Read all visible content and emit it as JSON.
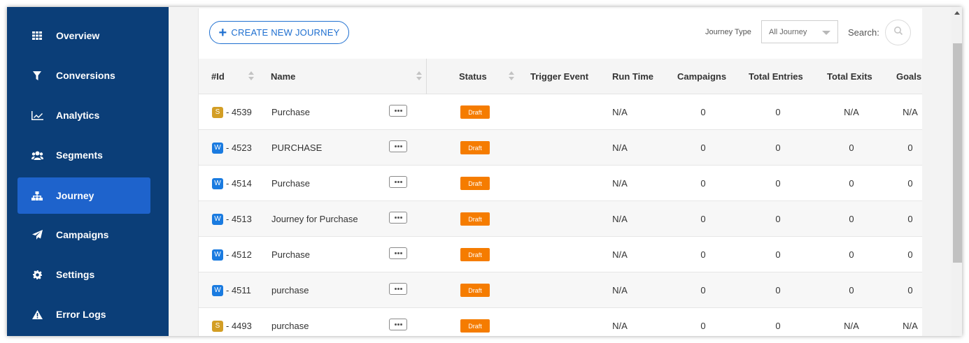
{
  "sidebar": {
    "items": [
      {
        "label": "Overview",
        "icon": "grid-icon",
        "active": false
      },
      {
        "label": "Conversions",
        "icon": "filter-icon",
        "active": false
      },
      {
        "label": "Analytics",
        "icon": "line-chart-icon",
        "active": false
      },
      {
        "label": "Segments",
        "icon": "users-icon",
        "active": false
      },
      {
        "label": "Journey",
        "icon": "sitemap-icon",
        "active": true
      },
      {
        "label": "Campaigns",
        "icon": "paper-plane-icon",
        "active": false
      },
      {
        "label": "Settings",
        "icon": "gear-icon",
        "active": false
      },
      {
        "label": "Error Logs",
        "icon": "warning-icon",
        "active": false
      }
    ]
  },
  "toolbar": {
    "create_label": "CREATE NEW JOURNEY",
    "journey_type_label": "Journey Type",
    "journey_type_value": "All Journey",
    "search_label": "Search:"
  },
  "table": {
    "headers": {
      "id": "#Id",
      "name": "Name",
      "status": "Status",
      "trigger": "Trigger Event",
      "runtime": "Run Time",
      "campaigns": "Campaigns",
      "entries": "Total Entries",
      "exits": "Total Exits",
      "goals": "Goals"
    },
    "rows": [
      {
        "type": "S",
        "id": "- 4539",
        "name": "Purchase",
        "status": "Draft",
        "trigger": "",
        "runtime": "N/A",
        "campaigns": "0",
        "entries": "0",
        "exits": "N/A",
        "goals": "N/A"
      },
      {
        "type": "W",
        "id": "- 4523",
        "name": "PURCHASE",
        "status": "Draft",
        "trigger": "",
        "runtime": "N/A",
        "campaigns": "0",
        "entries": "0",
        "exits": "0",
        "goals": "0"
      },
      {
        "type": "W",
        "id": "- 4514",
        "name": "Purchase",
        "status": "Draft",
        "trigger": "",
        "runtime": "N/A",
        "campaigns": "0",
        "entries": "0",
        "exits": "0",
        "goals": "0"
      },
      {
        "type": "W",
        "id": "- 4513",
        "name": "Journey for Purchase",
        "status": "Draft",
        "trigger": "",
        "runtime": "N/A",
        "campaigns": "0",
        "entries": "0",
        "exits": "0",
        "goals": "0"
      },
      {
        "type": "W",
        "id": "- 4512",
        "name": "Purchase",
        "status": "Draft",
        "trigger": "",
        "runtime": "N/A",
        "campaigns": "0",
        "entries": "0",
        "exits": "0",
        "goals": "0"
      },
      {
        "type": "W",
        "id": "- 4511",
        "name": "purchase",
        "status": "Draft",
        "trigger": "",
        "runtime": "N/A",
        "campaigns": "0",
        "entries": "0",
        "exits": "0",
        "goals": "0"
      },
      {
        "type": "S",
        "id": "- 4493",
        "name": "purchase",
        "status": "Draft",
        "trigger": "",
        "runtime": "N/A",
        "campaigns": "0",
        "entries": "0",
        "exits": "N/A",
        "goals": "N/A"
      }
    ]
  },
  "colors": {
    "sidebar_bg": "#0b3e78",
    "sidebar_active": "#1e63cc",
    "accent": "#1e6fd0",
    "draft_badge": "#f57c00",
    "type_s_badge": "#d39e25",
    "type_w_badge": "#1a7be0"
  }
}
